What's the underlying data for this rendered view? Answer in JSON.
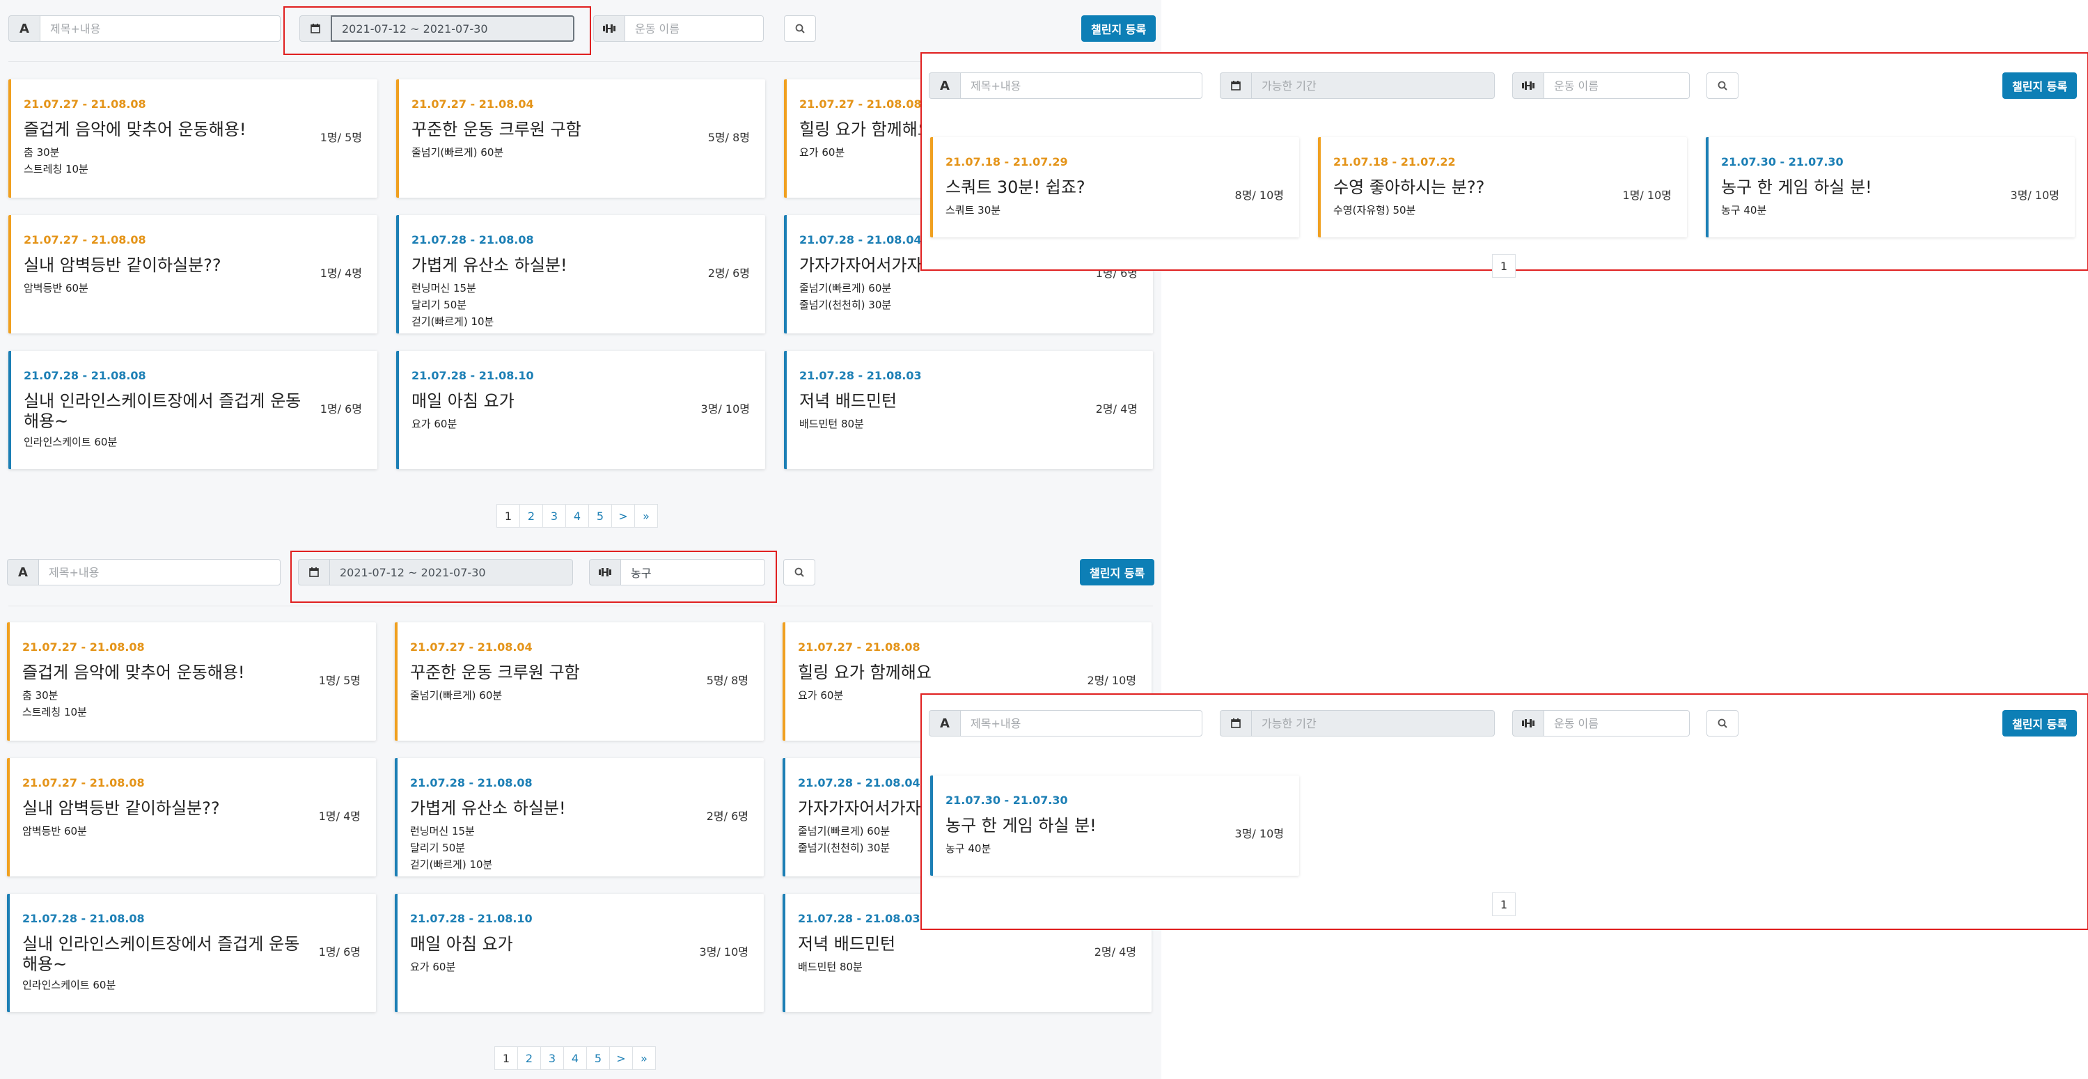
{
  "colors": {
    "accent": "#0d7fb6",
    "orange": "#e49419",
    "blue": "#1c7fb5",
    "highlight": "#e02020"
  },
  "icons": {
    "title": "letter-a-icon",
    "date": "calendar-icon",
    "exercise": "dumbbell-icon",
    "search": "magnifier-icon"
  },
  "toolbar": {
    "title_icon": "A",
    "title_placeholder": "제목+내용",
    "date_placeholder": "가능한 기간",
    "exercise_placeholder": "운동 이름",
    "register_label": "챌린지 등록"
  },
  "panel1": {
    "date_value": "2021-07-12 ~ 2021-07-30",
    "exercise_value": ""
  },
  "panel2": {
    "date_value": "2021-07-12 ~ 2021-07-30",
    "exercise_value": "농구"
  },
  "panel3": {
    "date_value": "",
    "exercise_value": ""
  },
  "panel4": {
    "date_value": "",
    "exercise_value": ""
  },
  "grid_cards": [
    {
      "dates": "21.07.27 - 21.08.08",
      "title": "즐겁게 음악에 맞추어 운동해용!",
      "count": "1명/ 5명",
      "exercises": [
        "춤 30분",
        "스트레칭 10분"
      ]
    },
    {
      "dates": "21.07.27 - 21.08.04",
      "title": "꾸준한 운동 크루원 구함",
      "count": "5명/ 8명",
      "exercises": [
        "줄넘기(빠르게) 60분"
      ]
    },
    {
      "dates": "21.07.27 - 21.08.08",
      "title": "힐링 요가 함께해요",
      "count": "2명/ 10명",
      "exercises": [
        "요가 60분"
      ]
    },
    {
      "dates": "21.07.27 - 21.08.08",
      "title": "실내 암벽등반 같이하실분??",
      "count": "1명/ 4명",
      "exercises": [
        "암벽등반 60분"
      ]
    },
    {
      "dates": "21.07.28 - 21.08.08",
      "title": "가볍게 유산소 하실분!",
      "count": "2명/ 6명",
      "exercises": [
        "런닝머신 15분",
        "달리기 50분",
        "걷기(빠르게) 10분"
      ]
    },
    {
      "dates": "21.07.28 - 21.08.04",
      "title": "가자가자어서가자",
      "count": "1명/ 6명",
      "exercises": [
        "줄넘기(빠르게) 60분",
        "줄넘기(천천히) 30분"
      ]
    },
    {
      "dates": "21.07.28 - 21.08.08",
      "title": "실내 인라인스케이트장에서 즐겁게 운동해용~",
      "count": "1명/ 6명",
      "exercises": [
        "인라인스케이트 60분"
      ]
    },
    {
      "dates": "21.07.28 - 21.08.10",
      "title": "매일 아침 요가",
      "count": "3명/ 10명",
      "exercises": [
        "요가 60분"
      ]
    },
    {
      "dates": "21.07.28 - 21.08.03",
      "title": "저녁 배드민턴",
      "count": "2명/ 4명",
      "exercises": [
        "배드민턴 80분"
      ]
    }
  ],
  "pages": [
    "1",
    "2",
    "3",
    "4",
    "5",
    ">",
    "»"
  ],
  "panel3_cards": [
    {
      "dates": "21.07.18 - 21.07.29",
      "title": "스쿼트 30분! 쉽죠?",
      "count": "8명/ 10명",
      "exercises": [
        "스쿼트 30분"
      ]
    },
    {
      "dates": "21.07.18 - 21.07.22",
      "title": "수영 좋아하시는 분??",
      "count": "1명/ 10명",
      "exercises": [
        "수영(자유형) 50분"
      ]
    },
    {
      "dates": "21.07.30 - 21.07.30",
      "title": "농구 한 게임 하실 분!",
      "count": "3명/ 10명",
      "exercises": [
        "농구 40분"
      ]
    }
  ],
  "panel4_cards": [
    {
      "dates": "21.07.30 - 21.07.30",
      "title": "농구 한 게임 하실 분!",
      "count": "3명/ 10명",
      "exercises": [
        "농구 40분"
      ]
    }
  ],
  "single_page": "1"
}
